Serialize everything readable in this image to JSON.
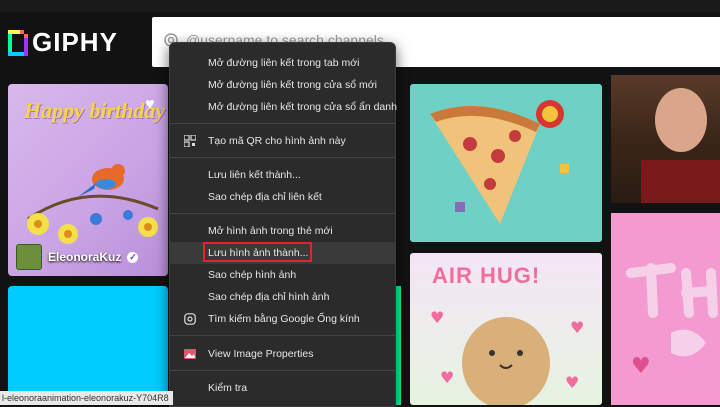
{
  "logo": {
    "text": "GIPHY"
  },
  "search": {
    "placeholder": "@username to search channels"
  },
  "tiles": {
    "birthday": {
      "text": "Happy birthday",
      "username": "EleonoraKuz"
    },
    "airhug": {
      "text": "AIR HUG!"
    }
  },
  "context_menu": {
    "items": [
      "Mở đường liên kết trong tab mới",
      "Mở đường liên kết trong cửa sổ mới",
      "Mở đường liên kết trong cửa sổ ẩn danh",
      "Tạo mã QR cho hình ảnh này",
      "Lưu liên kết thành...",
      "Sao chép địa chỉ liên kết",
      "Mở hình ảnh trong thẻ mới",
      "Lưu hình ảnh thành...",
      "Sao chép hình ảnh",
      "Sao chép địa chỉ hình ảnh",
      "Tìm kiếm bằng Google Ống kính",
      "View Image Properties",
      "Kiểm tra"
    ],
    "icons": {
      "qr": "qr-code-icon",
      "lens": "google-lens-icon",
      "properties": "image-properties-icon"
    }
  },
  "status_bar": {
    "url": "l-eleonoraanimation-eleonorakuz-Y704R8"
  },
  "colors": {
    "highlight_border": "#e3242b",
    "menu_bg": "#2b2b2b"
  }
}
